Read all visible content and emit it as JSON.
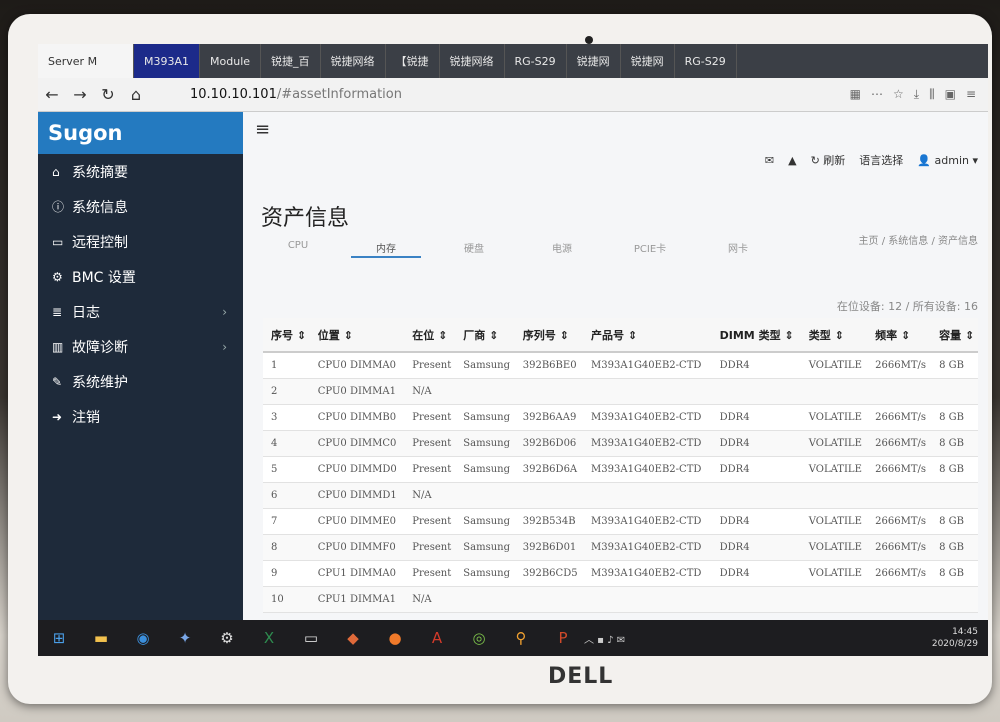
{
  "browser": {
    "tabs": [
      {
        "label": "Server M",
        "icon": "page-icon"
      },
      {
        "label": "M393A1",
        "icon": "page-icon"
      },
      {
        "label": "Module",
        "icon": "page-icon"
      },
      {
        "label": "锐捷_百",
        "icon": "page-icon"
      },
      {
        "label": "锐捷网络",
        "icon": "page-icon"
      },
      {
        "label": "【锐捷",
        "icon": "page-icon"
      },
      {
        "label": "锐捷网络",
        "icon": "page-icon"
      },
      {
        "label": "RG-S29",
        "icon": "page-icon"
      },
      {
        "label": "锐捷网",
        "icon": "page-icon"
      },
      {
        "label": "锐捷网",
        "icon": "page-icon"
      },
      {
        "label": "RG-S29",
        "icon": "page-icon"
      }
    ],
    "url_host": "10.10.10.101",
    "url_path": "/#assetInformation"
  },
  "app": {
    "logo": "Sugon",
    "menu_toggle": "≡",
    "sidebar": [
      {
        "label": "系统摘要",
        "icon": "home-icon",
        "glyph": "⌂"
      },
      {
        "label": "系统信息",
        "icon": "info-icon",
        "glyph": "ⓘ"
      },
      {
        "label": "远程控制",
        "icon": "monitor-icon",
        "glyph": "▭"
      },
      {
        "label": "BMC 设置",
        "icon": "gear-icon",
        "glyph": "⚙"
      },
      {
        "label": "日志",
        "icon": "database-icon",
        "glyph": "≣"
      },
      {
        "label": "故障诊断",
        "icon": "chart-icon",
        "glyph": "▥"
      },
      {
        "label": "系统维护",
        "icon": "wrench-icon",
        "glyph": "✎"
      },
      {
        "label": "注销",
        "icon": "logout-icon",
        "glyph": "➜"
      }
    ],
    "topbar": {
      "refresh": "刷新",
      "language": "语言选择",
      "user": "admin"
    },
    "page_title": "资产信息",
    "breadcrumb": "主页 / 系统信息 / 资产信息",
    "asset_tabs": [
      "CPU",
      "内存",
      "硬盘",
      "电源",
      "PCIE卡",
      "网卡"
    ],
    "active_tab": 1,
    "device_count": "在位设备: 12 / 所有设备: 16",
    "columns": [
      "序号 ⇕",
      "位置 ⇕",
      "在位 ⇕",
      "厂商 ⇕",
      "序列号 ⇕",
      "产品号 ⇕",
      "DIMM 类型 ⇕",
      "类型 ⇕",
      "频率 ⇕",
      "容量 ⇕"
    ],
    "rows": [
      [
        "1",
        "CPU0 DIMMA0",
        "Present",
        "Samsung",
        "392B6BE0",
        "M393A1G40EB2-CTD",
        "DDR4",
        "VOLATILE",
        "2666MT/s",
        "8 GB"
      ],
      [
        "2",
        "CPU0 DIMMA1",
        "N/A",
        "",
        "",
        "",
        "",
        "",
        "",
        ""
      ],
      [
        "3",
        "CPU0 DIMMB0",
        "Present",
        "Samsung",
        "392B6AA9",
        "M393A1G40EB2-CTD",
        "DDR4",
        "VOLATILE",
        "2666MT/s",
        "8 GB"
      ],
      [
        "4",
        "CPU0 DIMMC0",
        "Present",
        "Samsung",
        "392B6D06",
        "M393A1G40EB2-CTD",
        "DDR4",
        "VOLATILE",
        "2666MT/s",
        "8 GB"
      ],
      [
        "5",
        "CPU0 DIMMD0",
        "Present",
        "Samsung",
        "392B6D6A",
        "M393A1G40EB2-CTD",
        "DDR4",
        "VOLATILE",
        "2666MT/s",
        "8 GB"
      ],
      [
        "6",
        "CPU0 DIMMD1",
        "N/A",
        "",
        "",
        "",
        "",
        "",
        "",
        ""
      ],
      [
        "7",
        "CPU0 DIMME0",
        "Present",
        "Samsung",
        "392B534B",
        "M393A1G40EB2-CTD",
        "DDR4",
        "VOLATILE",
        "2666MT/s",
        "8 GB"
      ],
      [
        "8",
        "CPU0 DIMMF0",
        "Present",
        "Samsung",
        "392B6D01",
        "M393A1G40EB2-CTD",
        "DDR4",
        "VOLATILE",
        "2666MT/s",
        "8 GB"
      ],
      [
        "9",
        "CPU1 DIMMA0",
        "Present",
        "Samsung",
        "392B6CD5",
        "M393A1G40EB2-CTD",
        "DDR4",
        "VOLATILE",
        "2666MT/s",
        "8 GB"
      ],
      [
        "10",
        "CPU1 DIMMA1",
        "N/A",
        "",
        "",
        "",
        "",
        "",
        "",
        ""
      ]
    ]
  },
  "taskbar": {
    "apps": [
      "windows-icon",
      "folder-icon",
      "browser-icon",
      "bird-icon",
      "gear-icon",
      "excel-icon",
      "terminal-icon",
      "paint-icon",
      "firefox-icon",
      "acrobat-icon",
      "wechat-icon",
      "search-icon",
      "powerpoint-icon"
    ],
    "time": "14:45",
    "date": "2020/8/29"
  },
  "device_brand": "DELL"
}
